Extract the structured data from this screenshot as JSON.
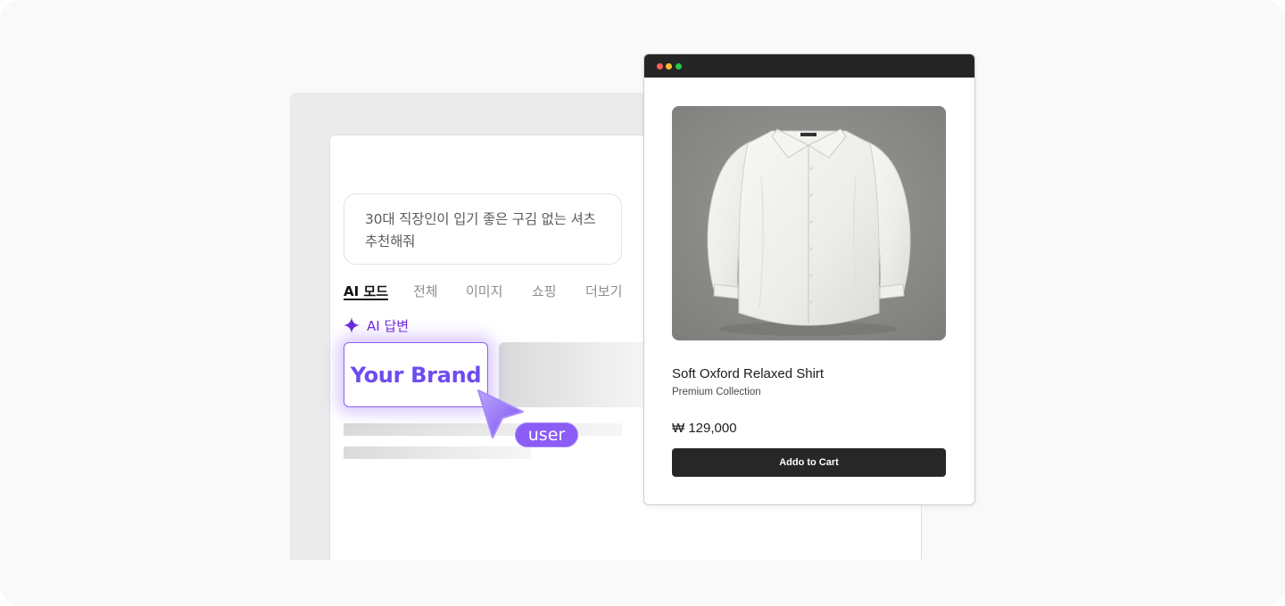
{
  "search": {
    "query": "30대 직장인이 입기 좋은 구김 없는 셔츠 추천해줘",
    "tabs": [
      {
        "label": "AI 모드",
        "active": true
      },
      {
        "label": "전체",
        "active": false
      },
      {
        "label": "이미지",
        "active": false
      },
      {
        "label": "쇼핑",
        "active": false
      },
      {
        "label": "더보기",
        "active": false
      }
    ],
    "ai_answer_label": "AI 답변",
    "brand_card_text": "Your Brand",
    "cursor_tag": "user"
  },
  "product": {
    "window_dots": [
      "#ff5f57",
      "#febc2e",
      "#28c840"
    ],
    "image_icon": "white-shirt-photo",
    "name": "Soft Oxford Relaxed Shirt",
    "subtitle": "Premium Collection",
    "price": "₩ 129,000",
    "cta_label": "Addo to Cart"
  },
  "colors": {
    "accent": "#6d4cf0",
    "accent_light": "#8b5cf6",
    "ai_label": "#6d28d9",
    "button_dark": "#272727"
  }
}
